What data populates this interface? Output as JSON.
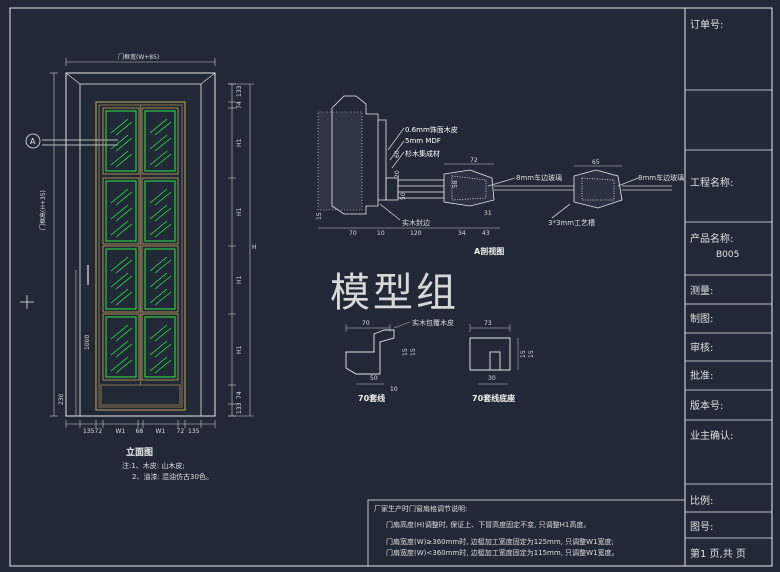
{
  "watermark": "模型组",
  "title_block": {
    "order_no": "订单号:",
    "project_name": "工程名称:",
    "product_name": "产品名称:",
    "product_code": "B005",
    "surveyed": "测量:",
    "drawn": "制图:",
    "reviewed": "审核:",
    "approved": "批准:",
    "version": "版本号:",
    "owner_confirm": "业主确认:",
    "scale": "比例:",
    "drawing_no": "图号:",
    "page": "第1  页,共    页"
  },
  "elevation": {
    "caption": "立面图",
    "notes": [
      "注:1、木皮: 山木皮;",
      "2、油漆: 混油仿古30色。"
    ],
    "top_dim": "门框宽(W+85)",
    "left_dim": "门框高(H+35)",
    "handle_dim": "1000",
    "bottom_dims": [
      "135",
      "72",
      "W1",
      "68",
      "W1",
      "72",
      "135"
    ],
    "bottom_left_dim": "230",
    "right_dims": [
      "133",
      "74",
      "H1",
      "H1",
      "H1",
      "H1",
      "74",
      "133"
    ],
    "right_total": "H",
    "section_marker": "A"
  },
  "section_detail": {
    "caption": "A剖视图",
    "layer_labels": [
      "0.6mm饰面木皮",
      "5mm MDF",
      "杉木集成材"
    ],
    "solid_edge": "实木封边",
    "glass_strip_1": "8mm车边玻璃",
    "glass_strip_2": "8mm车边玻璃",
    "craft_slot": "3*3mm工艺槽",
    "dims_top": [
      "72",
      "65"
    ],
    "dims_bottom": [
      "70",
      "10",
      "120",
      "34",
      "43",
      "31"
    ],
    "dims_vert": [
      "60",
      "20",
      "15",
      "50",
      "58"
    ]
  },
  "casing_70": {
    "caption": "70套线",
    "label": "实木包覆木皮",
    "dims": [
      "70",
      "50",
      "10",
      "15",
      "15"
    ]
  },
  "casing_base": {
    "caption": "70套线底座",
    "dims": [
      "73",
      "30",
      "15",
      "15"
    ]
  },
  "factory_notes": {
    "title": "厂家生产时门窗扇格调节说明:",
    "lines": [
      "门扇高度(H)调整时, 保证上、下冒高度固定不变, 只调整H1高度。",
      "门扇宽度(W)≥360mm时, 边梃加工宽度固定为125mm, 只调整W1宽度;",
      "门扇宽度(W)<360mm时, 边梃加工宽度固定为115mm, 只调整W1宽度。"
    ]
  },
  "colors": {
    "background": "#222936",
    "line": "#e8e8e8",
    "door_frame": "#c8a55a",
    "glass": "#2ee84a",
    "dim": "#cccccc"
  }
}
